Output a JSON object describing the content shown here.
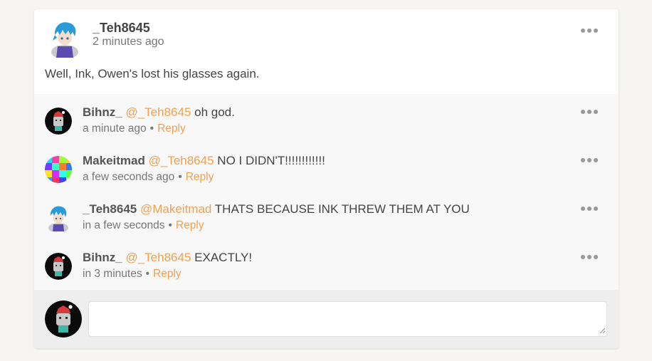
{
  "post": {
    "author": "_Teh8645",
    "time": "2 minutes ago",
    "text": "Well, Ink, Owen's lost his glasses again.",
    "more_icon": "more-horizontal-icon"
  },
  "replies": [
    {
      "author": "Bihnz_",
      "mention": "@_Teh8645",
      "text": " oh god.",
      "time": "a minute ago",
      "separator": "•",
      "reply_label": "Reply",
      "avatar": "santa-hat-avatar"
    },
    {
      "author": "Makeitmad",
      "mention": "@_Teh8645",
      "text": "NO I DIDN'T!!!!!!!!!!!!",
      "time": "a few seconds ago",
      "separator": "•",
      "reply_label": "Reply",
      "avatar": "colorful-pixel-avatar"
    },
    {
      "author": "_Teh8645",
      "mention": "@Makeitmad",
      "text": "THATS BECAUSE INK THREW THEM AT YOU",
      "time": "in a few seconds",
      "separator": "•",
      "reply_label": "Reply",
      "avatar": "blue-hair-avatar"
    },
    {
      "author": "Bihnz_",
      "mention": "@_Teh8645",
      "text": "EXACTLY!",
      "time": "in 3 minutes",
      "separator": "•",
      "reply_label": "Reply",
      "avatar": "santa-hat-avatar"
    }
  ],
  "composer": {
    "value": "",
    "placeholder": "",
    "avatar": "santa-hat-avatar"
  },
  "colors": {
    "accent": "#f0a055",
    "page_background": "#f6f5f2",
    "replies_background": "#f8f8f8",
    "composer_background": "#eeeeee"
  }
}
